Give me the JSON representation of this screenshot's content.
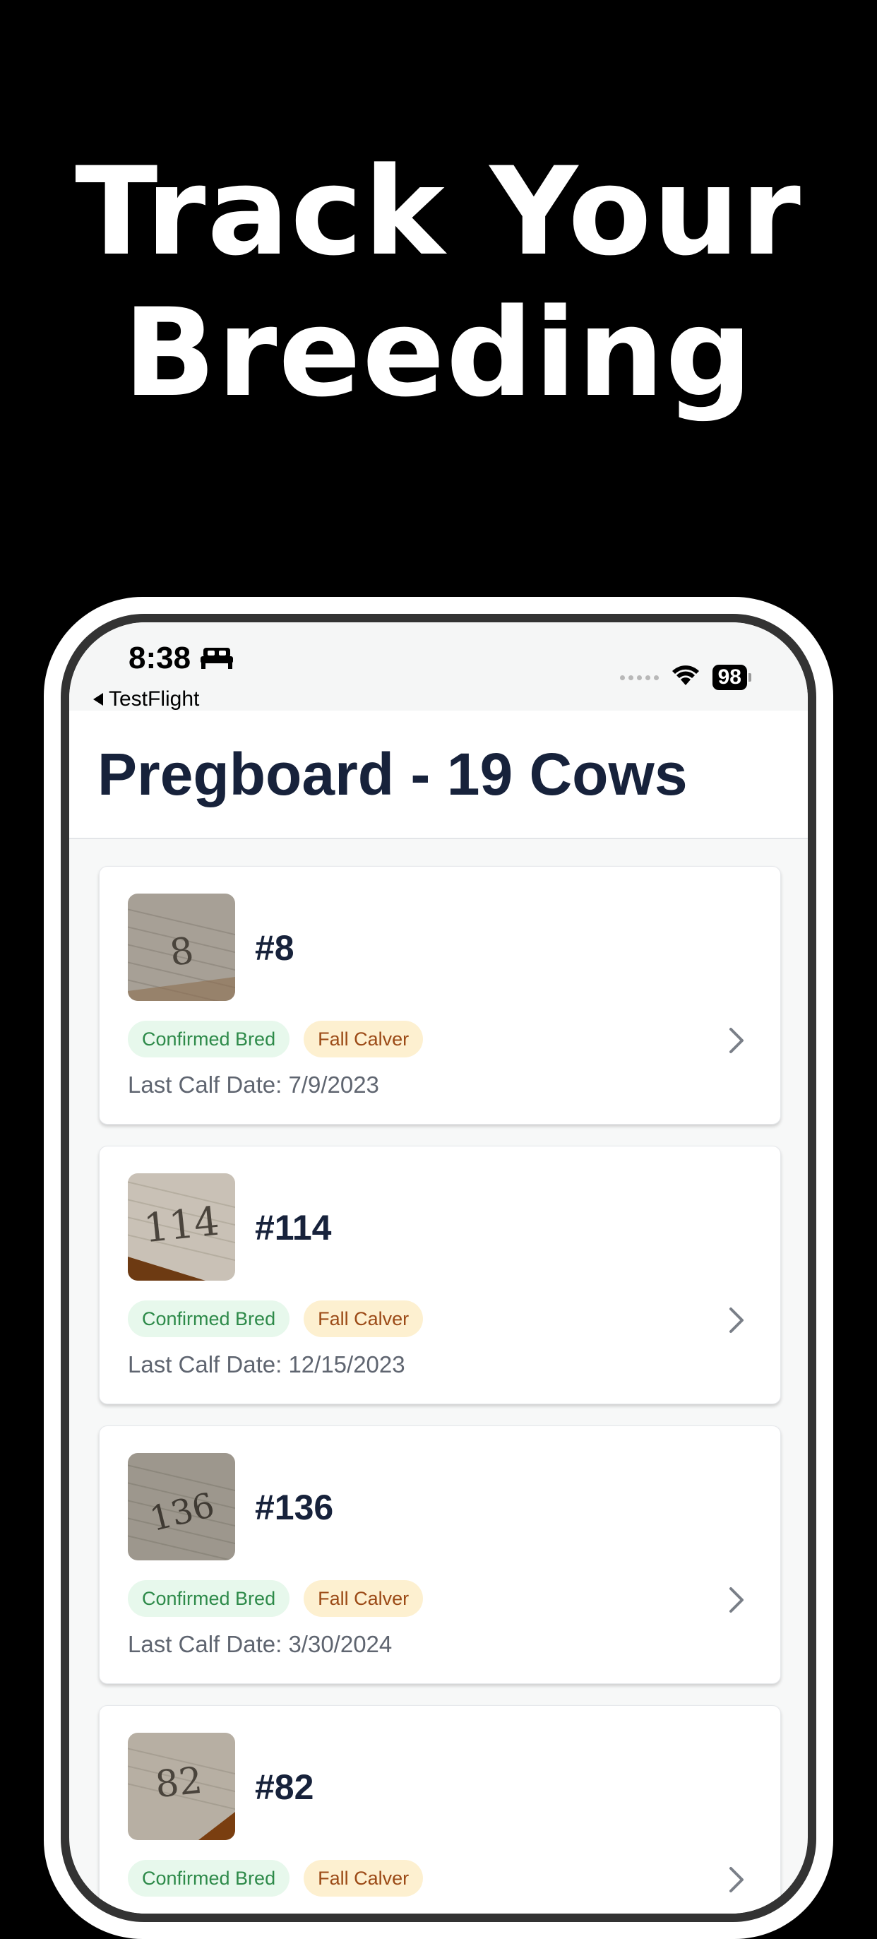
{
  "headline": {
    "line1": "Track Your",
    "line2": "Breeding"
  },
  "status_bar": {
    "time": "8:38",
    "back_app": "TestFlight",
    "battery": "98",
    "icons": [
      "bed-icon",
      "signal-icon",
      "wifi-icon",
      "battery-icon"
    ]
  },
  "header": {
    "title": "Pregboard - 19 Cows"
  },
  "cows": [
    {
      "name": "#8",
      "photo_text": "8",
      "status_badge": "Confirmed Bred",
      "season_badge": "Fall Calver",
      "last_calf": "Last Calf Date: 7/9/2023"
    },
    {
      "name": "#114",
      "photo_text": "114",
      "status_badge": "Confirmed Bred",
      "season_badge": "Fall Calver",
      "last_calf": "Last Calf Date: 12/15/2023"
    },
    {
      "name": "#136",
      "photo_text": "136",
      "status_badge": "Confirmed Bred",
      "season_badge": "Fall Calver",
      "last_calf": "Last Calf Date: 3/30/2024"
    },
    {
      "name": "#82",
      "photo_text": "82",
      "status_badge": "Confirmed Bred",
      "season_badge": "Fall Calver",
      "last_calf": ""
    }
  ],
  "colors": {
    "background": "#000000",
    "title_text": "#17223b",
    "bred_badge_bg": "#e7f8ec",
    "bred_badge_text": "#2d8a49",
    "calver_badge_bg": "#fdf0d0",
    "calver_badge_text": "#9b4a16"
  }
}
